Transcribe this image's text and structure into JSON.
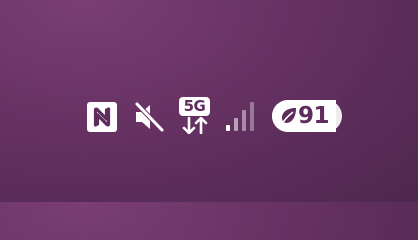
{
  "status_bar": {
    "icons": [
      {
        "name": "nfc-icon",
        "color": "#ffffff"
      },
      {
        "name": "mute-icon",
        "color": "#ffffff"
      },
      {
        "name": "network-5g-icon",
        "label": "5G",
        "color": "#ffffff"
      },
      {
        "name": "signal-strength-icon",
        "bars_active": 1,
        "bars_total": 4,
        "color": "#ffffff"
      }
    ],
    "battery": {
      "level": "91",
      "fill_fraction": 0.91,
      "mode_icon": "leaf-icon",
      "color": "#ffffff",
      "text_color": "#5e2d5d"
    }
  },
  "background": {
    "color_top": "#7a3e75",
    "color_bottom": "#4e284f"
  }
}
